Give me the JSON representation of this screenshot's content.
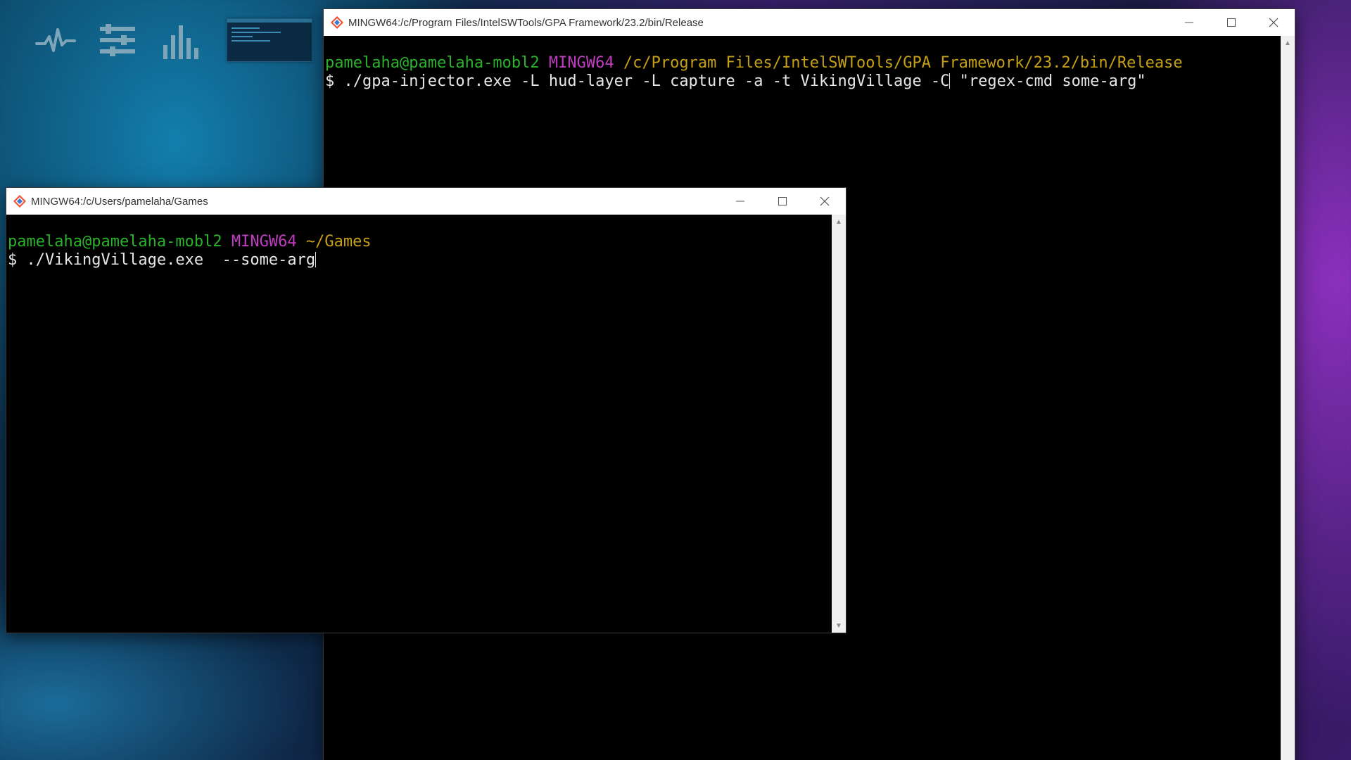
{
  "desktop": {
    "widgets": [
      {
        "icon": "activity-pulse-icon"
      },
      {
        "icon": "sliders-icon"
      },
      {
        "icon": "bar-chart-icon"
      },
      {
        "icon": "window-thumbnail"
      }
    ]
  },
  "window_back": {
    "title": "MINGW64:/c/Program Files/IntelSWTools/GPA Framework/23.2/bin/Release",
    "prompt_user": "pamelaha@pamelaha-mobl2",
    "prompt_host": "MINGW64",
    "prompt_path": "/c/Program Files/IntelSWTools/GPA Framework/23.2/bin/Release",
    "command_prefix": "$ ./gpa-injector.exe -L hud-layer -L capture -a -t VikingVillage -C",
    "command_suffix": " \"regex-cmd some-arg\""
  },
  "window_front": {
    "title": "MINGW64:/c/Users/pamelaha/Games",
    "prompt_user": "pamelaha@pamelaha-mobl2",
    "prompt_host": "MINGW64",
    "prompt_path": "~/Games",
    "command": "$ ./VikingVillage.exe  --some-arg"
  },
  "colors": {
    "user": "#2ab32a",
    "host": "#c23cc2",
    "path": "#c6a014",
    "terminal_bg": "#000000",
    "text": "#e6e6e6"
  }
}
